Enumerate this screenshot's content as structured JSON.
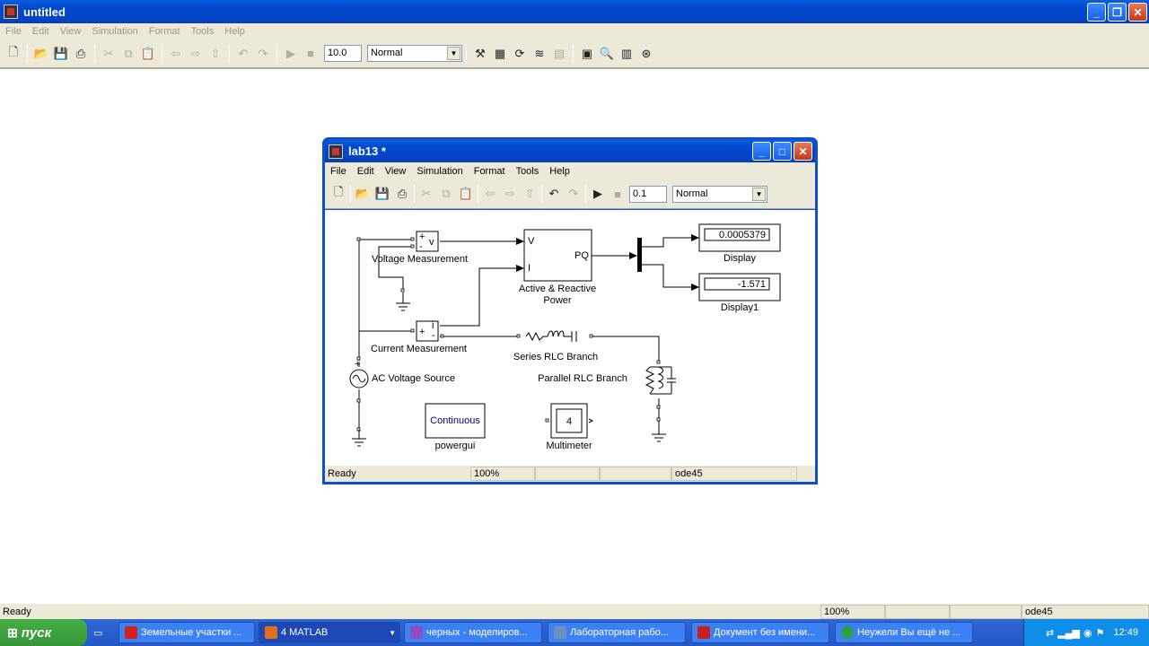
{
  "main_window": {
    "title": "untitled",
    "menu": [
      "File",
      "Edit",
      "View",
      "Simulation",
      "Format",
      "Tools",
      "Help"
    ],
    "stop_time": "10.0",
    "sim_mode": "Normal",
    "status": {
      "ready": "Ready",
      "zoom": "100%",
      "solver": "ode45"
    }
  },
  "model_window": {
    "title": "lab13 *",
    "menu": [
      "File",
      "Edit",
      "View",
      "Simulation",
      "Format",
      "Tools",
      "Help"
    ],
    "stop_time": "0.1",
    "sim_mode": "Normal",
    "status": {
      "ready": "Ready",
      "zoom": "100%",
      "solver": "ode45"
    }
  },
  "diagram": {
    "voltage_measurement": {
      "label": "Voltage Measurement",
      "port": "v"
    },
    "current_measurement": {
      "label": "Current Measurement",
      "port": "i"
    },
    "power": {
      "label_line1": "Active & Reactive",
      "label_line2": "Power",
      "in_v": "V",
      "in_i": "I",
      "out": "PQ"
    },
    "display": {
      "label": "Display",
      "value": "0.0005379"
    },
    "display1": {
      "label": "Display1",
      "value": "-1.571"
    },
    "ac_source": {
      "label": "AC Voltage Source"
    },
    "series_rlc": {
      "label": "Series RLC Branch"
    },
    "parallel_rlc": {
      "label": "Parallel RLC Branch"
    },
    "powergui": {
      "label": "powergui",
      "mode": "Continuous"
    },
    "multimeter": {
      "label": "Multimeter",
      "value": "4"
    }
  },
  "taskbar": {
    "start_label": "пуск",
    "buttons": [
      {
        "label": "Земельные участки ...",
        "color": "#d42020"
      },
      {
        "label": "4 MATLAB",
        "color": "#e07020"
      },
      {
        "label": "черных - моделиров...",
        "color": "#8a4fc0"
      },
      {
        "label": "Лабораторная рабо...",
        "color": "#6f8fbf"
      },
      {
        "label": "Документ без имени...",
        "color": "#c82020"
      },
      {
        "label": "Неужели Вы ещё не ...",
        "color": "#2f9e44"
      }
    ],
    "clock": "12:49"
  },
  "icons": {
    "colors": {
      "accent": "#0348cf",
      "close": "#c6391a",
      "xp_bar": "#3168d5"
    }
  }
}
